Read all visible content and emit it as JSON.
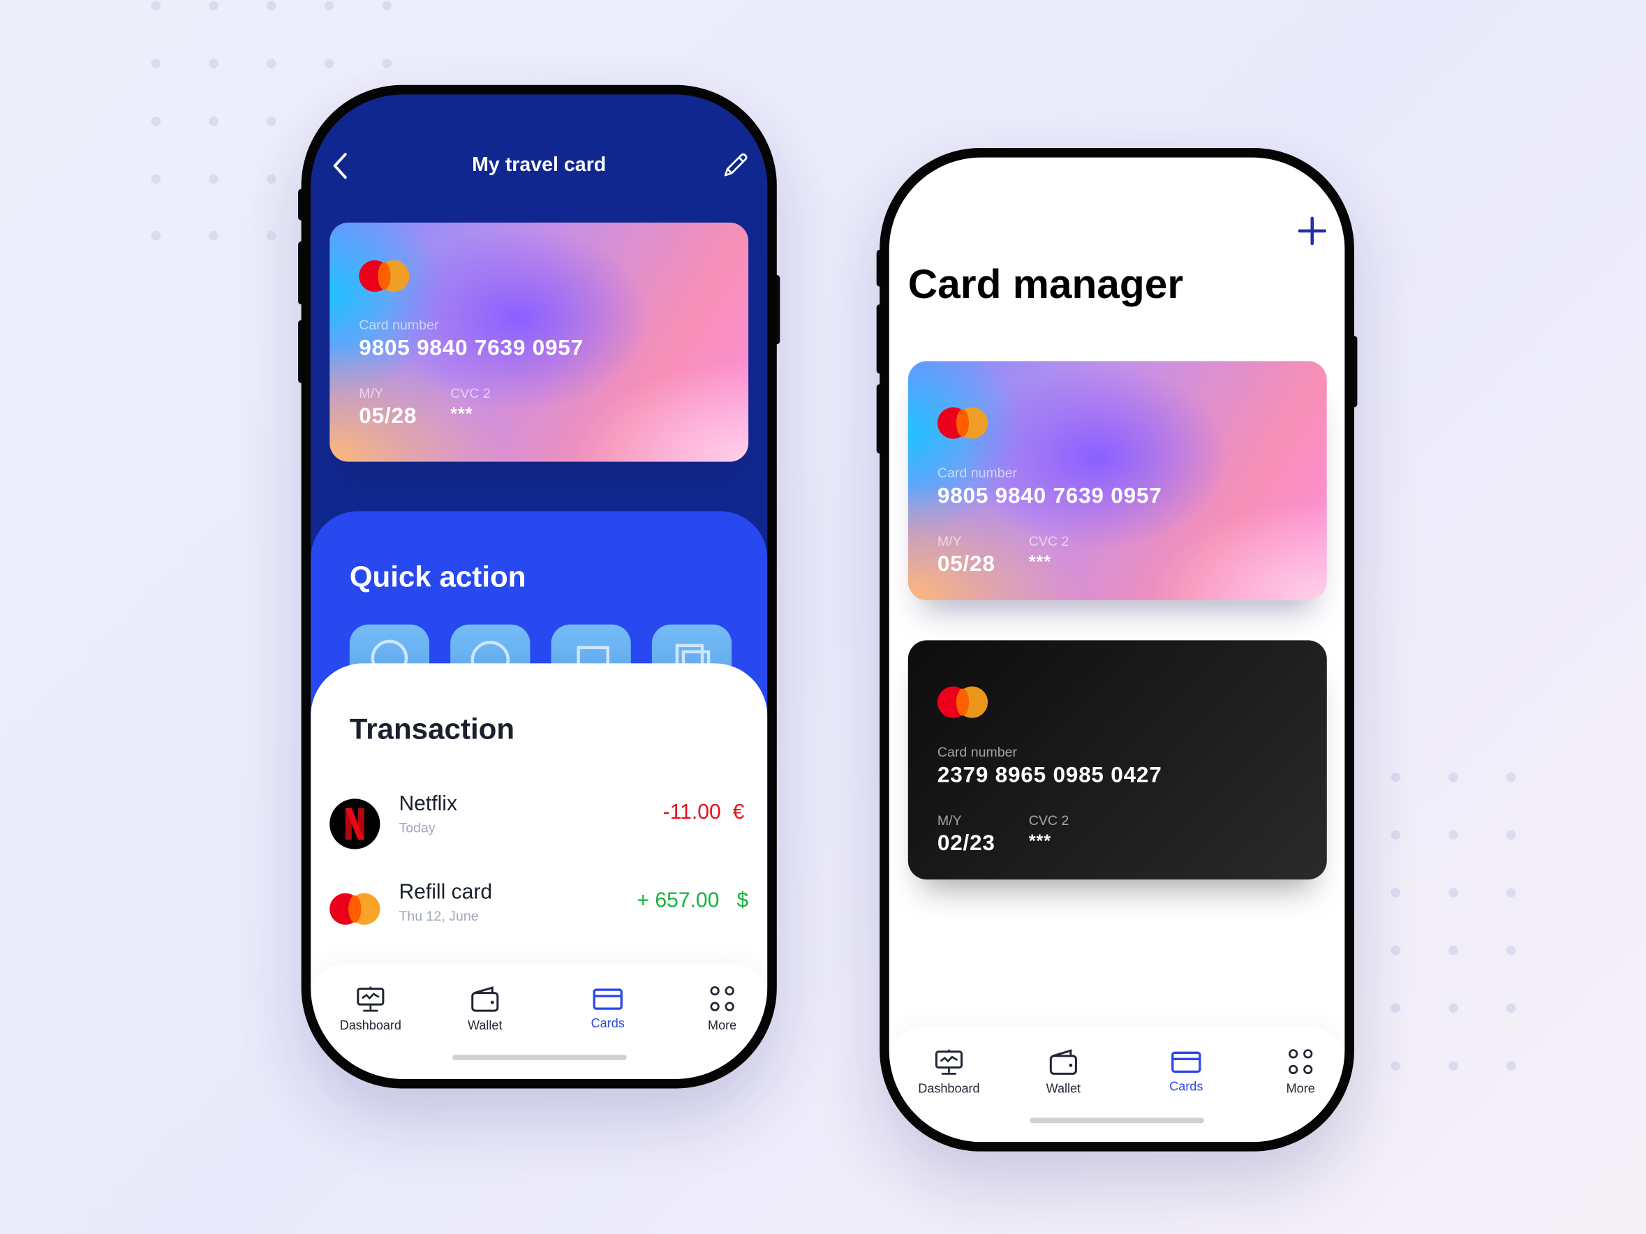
{
  "left_phone": {
    "header": {
      "title": "My travel card",
      "back_icon": "chevron-left-icon",
      "edit_icon": "pencil-icon"
    },
    "card": {
      "brand_icon": "mastercard-logo",
      "number_label": "Card number",
      "number": "9805 9840 7639 0957",
      "expiry_label": "M/Y",
      "expiry": "05/28",
      "cvc_label": "CVC 2",
      "cvc": "***"
    },
    "quick_action": {
      "title": "Quick action",
      "buttons": [
        {
          "icon": "history-icon"
        },
        {
          "icon": "currency-exchange-icon"
        },
        {
          "icon": "transfer-icon"
        },
        {
          "icon": "copy-icon"
        }
      ]
    },
    "transactions": {
      "title": "Transaction",
      "items": [
        {
          "name": "Netflix",
          "date": "Today",
          "amount": "-11.00",
          "currency": "€",
          "icon": "netflix-logo",
          "color": "#e8101c"
        },
        {
          "name": "Refill card",
          "date": "Thu 12, June",
          "amount": "+ 657.00",
          "currency": "$",
          "icon": "mastercard-logo",
          "color": "#16b33c"
        }
      ]
    }
  },
  "right_phone": {
    "add_icon": "plus-icon",
    "title": "Card manager",
    "cards": [
      {
        "style": "gradient",
        "number_label": "Card number",
        "number": "9805 9840 7639 0957",
        "expiry_label": "M/Y",
        "expiry": "05/28",
        "cvc_label": "CVC 2",
        "cvc": "***"
      },
      {
        "style": "black",
        "number_label": "Card number",
        "number": "2379 8965 0985 0427",
        "expiry_label": "M/Y",
        "expiry": "02/23",
        "cvc_label": "CVC 2",
        "cvc": "***"
      }
    ]
  },
  "nav": {
    "items": [
      {
        "label": "Dashboard",
        "icon": "dashboard-icon"
      },
      {
        "label": "Wallet",
        "icon": "wallet-icon"
      },
      {
        "label": "Cards",
        "icon": "card-icon",
        "active": true
      },
      {
        "label": "More",
        "icon": "more-icon"
      }
    ]
  },
  "colors": {
    "header_blue": "#10278f",
    "panel_blue": "#2848f0",
    "accent": "#2b47e8",
    "negative": "#e8101c",
    "positive": "#16b33c"
  }
}
